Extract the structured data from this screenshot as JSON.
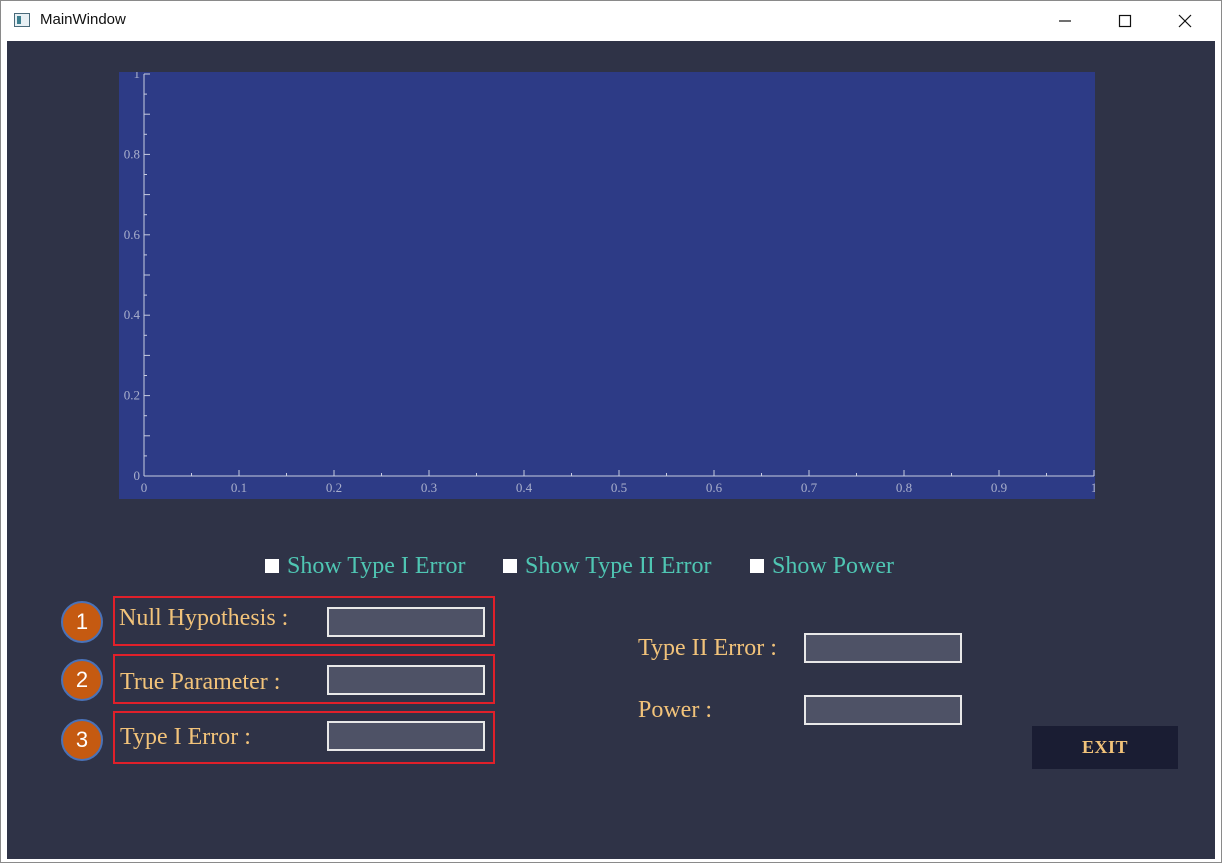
{
  "window": {
    "title": "MainWindow",
    "controls": [
      "minimize-icon",
      "maximize-icon",
      "close-icon"
    ]
  },
  "colors": {
    "background": "#2f3347",
    "plot_background": "#2d3b86",
    "label": "#f2c37a",
    "checkbox_label": "#4fc6b3",
    "highlight_border": "#e0202a",
    "badge": "#c55a11"
  },
  "plot": {
    "x_ticks": [
      "0",
      "0.1",
      "0.2",
      "0.3",
      "0.4",
      "0.5",
      "0.6",
      "0.7",
      "0.8",
      "0.9",
      "1"
    ],
    "y_ticks": [
      "0",
      "0.2",
      "0.4",
      "0.6",
      "0.8",
      "1"
    ]
  },
  "chart_data": {
    "type": "line",
    "series": [],
    "xlim": [
      0,
      1
    ],
    "ylim": [
      0,
      1
    ],
    "x_ticks": [
      0,
      0.1,
      0.2,
      0.3,
      0.4,
      0.5,
      0.6,
      0.7,
      0.8,
      0.9,
      1
    ],
    "y_ticks": [
      0,
      0.2,
      0.4,
      0.6,
      0.8,
      1
    ],
    "grid": false
  },
  "checkboxes": [
    {
      "label": "Show Type I Error",
      "checked": false
    },
    {
      "label": "Show Type II Error",
      "checked": false
    },
    {
      "label": "Show Power",
      "checked": false
    }
  ],
  "inputs": {
    "null_hypothesis": {
      "label": "Null Hypothesis :",
      "value": "",
      "badge": "1"
    },
    "true_parameter": {
      "label": "True Parameter :",
      "value": "",
      "badge": "2"
    },
    "type1_error": {
      "label": "Type I Error :",
      "value": "",
      "badge": "3"
    }
  },
  "outputs": {
    "type2_error": {
      "label": "Type II Error :",
      "value": ""
    },
    "power": {
      "label": "Power :",
      "value": ""
    }
  },
  "exit_label": "EXIT"
}
